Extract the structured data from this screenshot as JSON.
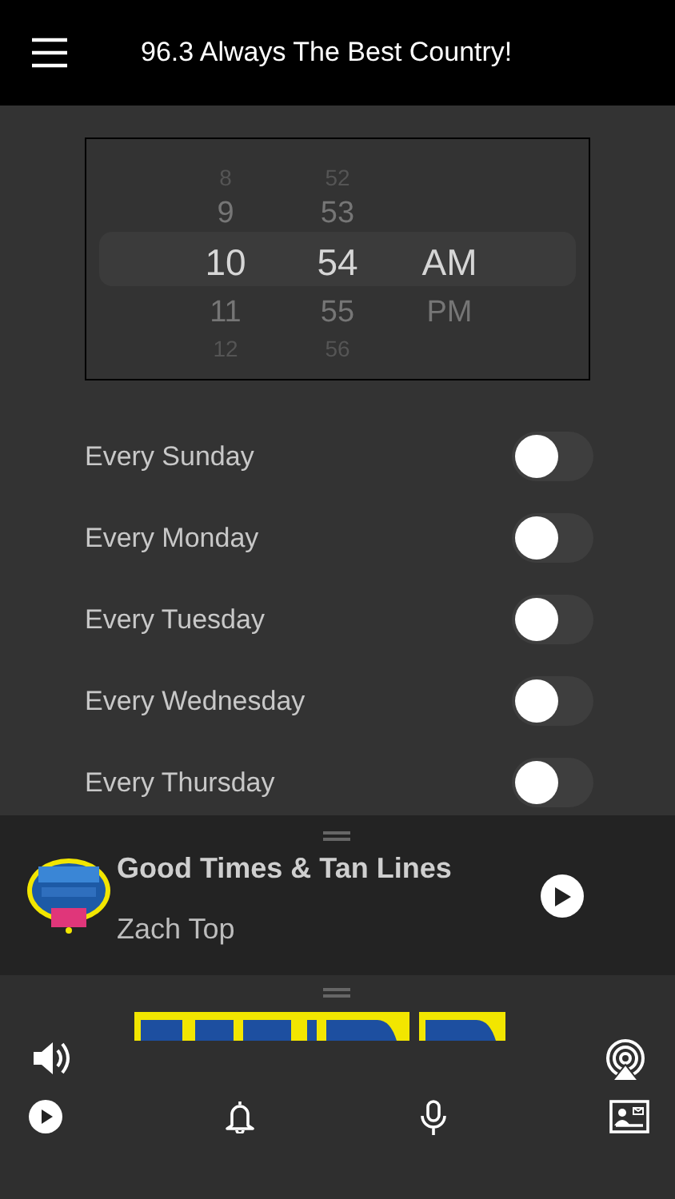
{
  "header": {
    "title": "96.3 Always The Best Country!"
  },
  "time_picker": {
    "hours": [
      {
        "label": "8",
        "selected": false
      },
      {
        "label": "9",
        "selected": false
      },
      {
        "label": "10",
        "selected": true
      },
      {
        "label": "11",
        "selected": false
      },
      {
        "label": "12",
        "selected": false
      }
    ],
    "minutes": [
      {
        "label": "52",
        "selected": false
      },
      {
        "label": "53",
        "selected": false
      },
      {
        "label": "54",
        "selected": true
      },
      {
        "label": "55",
        "selected": false
      },
      {
        "label": "56",
        "selected": false
      }
    ],
    "periods": [
      {
        "label": "AM",
        "selected": true
      },
      {
        "label": "PM",
        "selected": false
      }
    ]
  },
  "alarm_days": [
    {
      "label": "Every Sunday",
      "on": false
    },
    {
      "label": "Every Monday",
      "on": false
    },
    {
      "label": "Every Tuesday",
      "on": false
    },
    {
      "label": "Every Wednesday",
      "on": false
    },
    {
      "label": "Every Thursday",
      "on": false
    }
  ],
  "now_playing": {
    "title": "Good Times & Tan Lines",
    "artist": "Zach Top"
  }
}
